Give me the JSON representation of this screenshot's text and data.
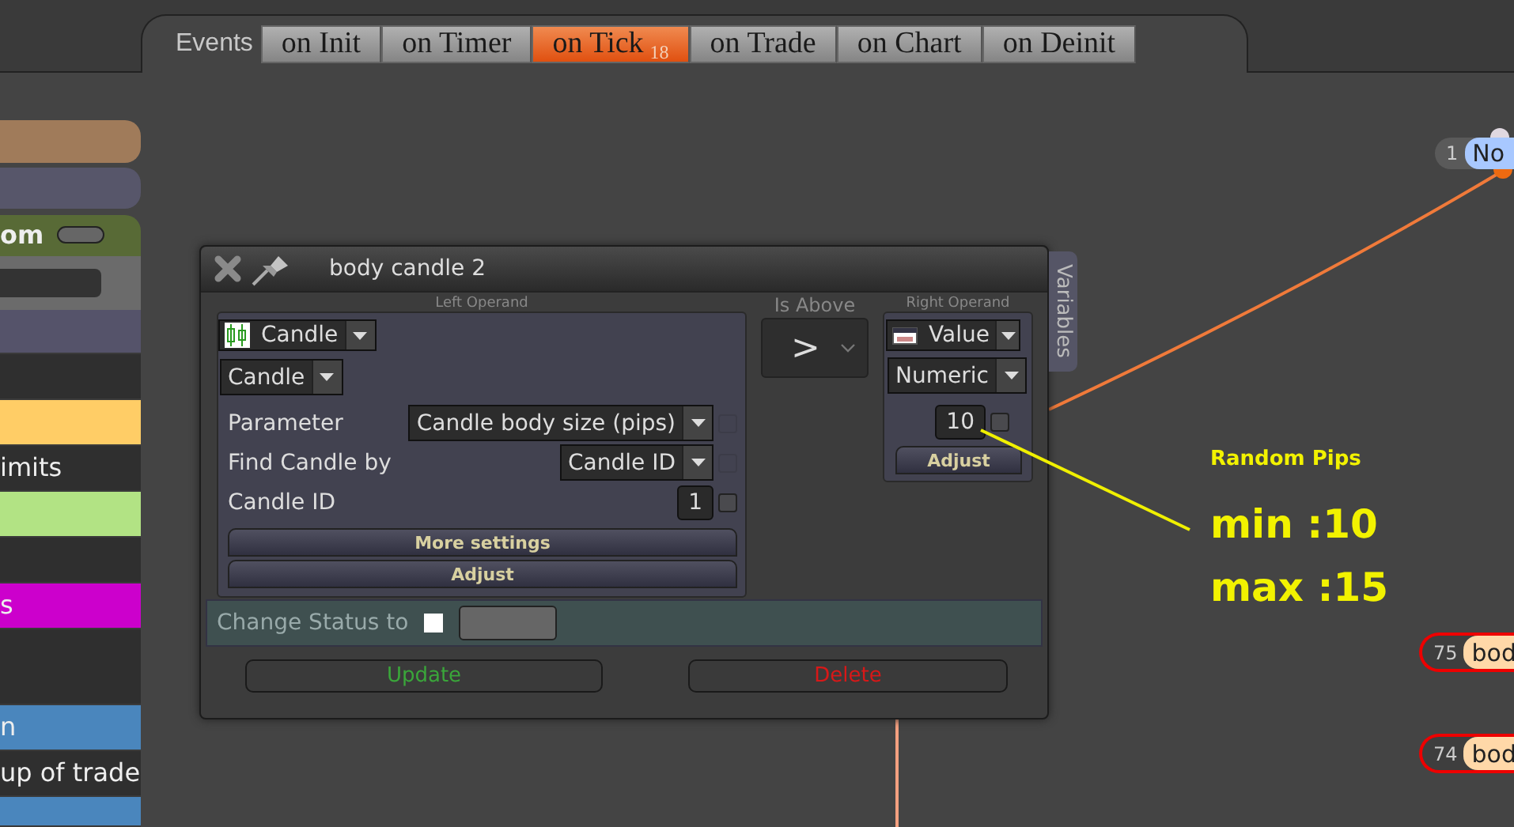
{
  "events_bar": {
    "label": "Events",
    "tabs": [
      {
        "label": "on Init",
        "selected": false
      },
      {
        "label": "on Timer",
        "selected": false
      },
      {
        "label": "on Tick",
        "badge": "18",
        "selected": true
      },
      {
        "label": "on Trade",
        "selected": false
      },
      {
        "label": "on Chart",
        "selected": false
      },
      {
        "label": "on Deinit",
        "selected": false
      }
    ]
  },
  "sidebar": {
    "items": [
      {
        "kind": "pill",
        "color": "#a07b5a"
      },
      {
        "kind": "pill",
        "color": "#57566a"
      },
      {
        "kind": "header",
        "color": "#586a36",
        "label": "om"
      },
      {
        "kind": "field",
        "color": "#6b6b6b"
      },
      {
        "kind": "row",
        "color": "#55536a"
      },
      {
        "kind": "row",
        "color": "#2f2f2f"
      },
      {
        "kind": "row",
        "color": "#ffcd66"
      },
      {
        "kind": "row",
        "color": "#2f2f2f",
        "label": "imits"
      },
      {
        "kind": "row",
        "color": "#b2e384"
      },
      {
        "kind": "row",
        "color": "#2f2f2f"
      },
      {
        "kind": "row",
        "color": "#cc00cc",
        "label": "s"
      },
      {
        "kind": "tall",
        "color": "#2f2f2f"
      },
      {
        "kind": "row",
        "color": "#4a86bd",
        "label": "n"
      },
      {
        "kind": "row",
        "color": "#2f2f2f",
        "label": "up of trade"
      },
      {
        "kind": "end",
        "color": "#4a86bd"
      }
    ]
  },
  "dialog": {
    "title": "body candle 2",
    "variables_tab": "Variables",
    "left_operand": {
      "caption": "Left Operand",
      "source": "Candle",
      "type": "Candle",
      "params": [
        {
          "kind": "dropdown",
          "label": "Parameter",
          "value": "Candle body size (pips)",
          "checked": false
        },
        {
          "kind": "dropdown",
          "label": "Find Candle by",
          "value": "Candle ID",
          "checked": false
        },
        {
          "kind": "input",
          "label": "Candle ID",
          "value": "1",
          "checked": false
        }
      ],
      "buttons": [
        "More settings",
        "Adjust"
      ]
    },
    "operator": {
      "caption": "Is Above",
      "symbol": ">"
    },
    "right_operand": {
      "caption": "Right Operand",
      "source": "Value",
      "type": "Numeric",
      "value": "10",
      "checked": false,
      "button": "Adjust"
    },
    "status": {
      "label": "Change Status to",
      "checked": false
    },
    "actions": [
      {
        "kind": "update",
        "label": "Update"
      },
      {
        "kind": "delete",
        "label": "Delete"
      }
    ]
  },
  "annotation": {
    "title": "Random Pips",
    "lines": [
      "min :10",
      "max :15"
    ]
  },
  "nodes": [
    {
      "number": "1",
      "label": "No",
      "color": "#a8c8ff",
      "flagged": false
    },
    {
      "number": "75",
      "label": "bod",
      "color": "#ffd8a8",
      "flagged": true
    },
    {
      "number": "74",
      "label": "bod",
      "color": "#ffd8a8",
      "flagged": true
    }
  ]
}
